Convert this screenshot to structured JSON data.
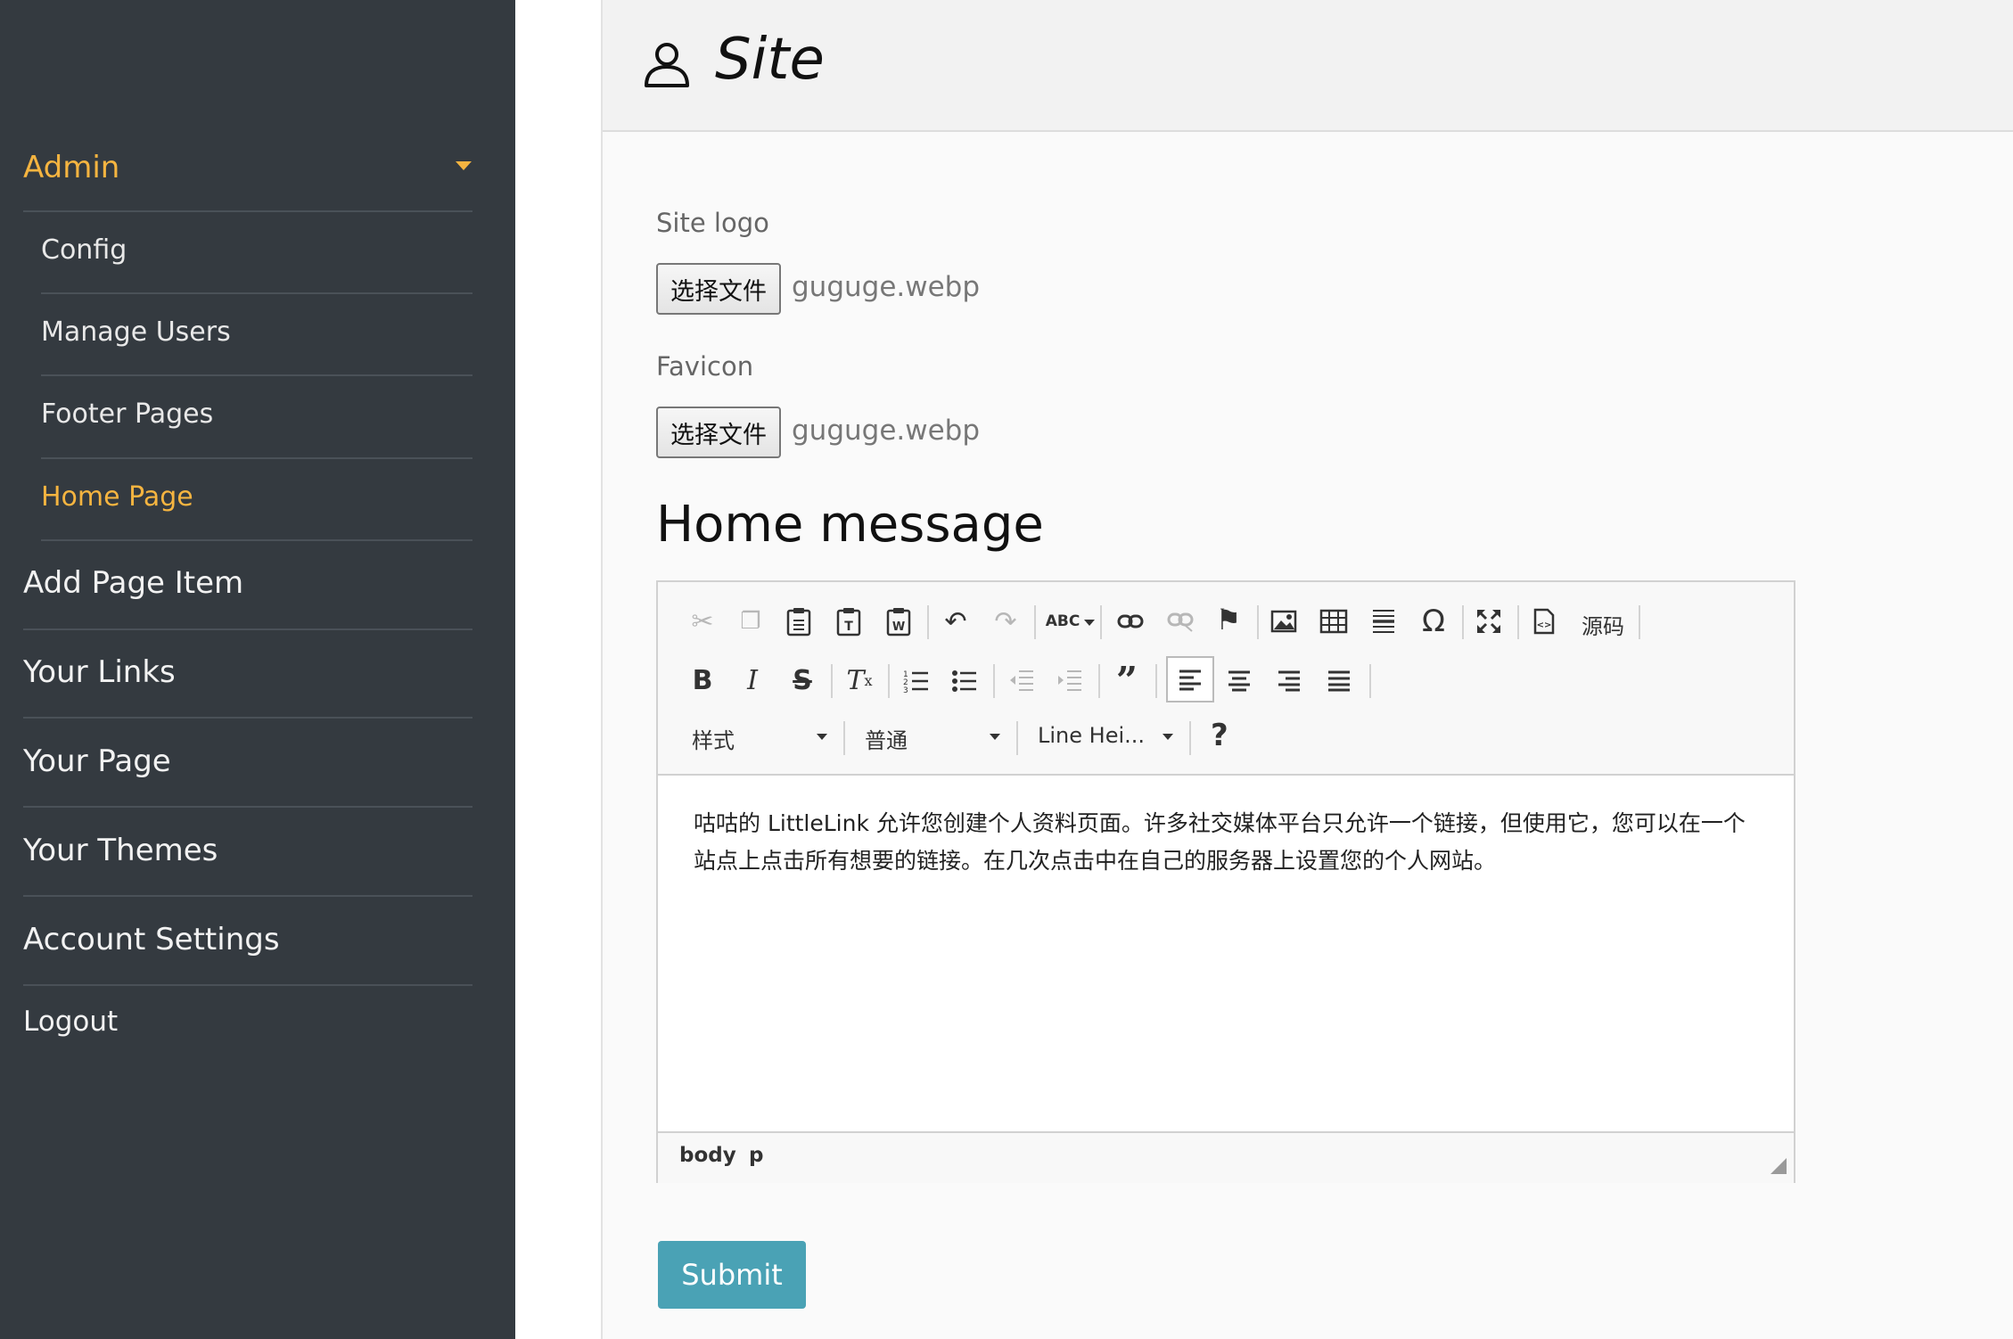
{
  "sidebar": {
    "admin_label": "Admin",
    "sub_items": [
      "Config",
      "Manage Users",
      "Footer Pages",
      "Home Page"
    ],
    "main_items": [
      "Add Page Item",
      "Your Links",
      "Your Page",
      "Your Themes",
      "Account Settings",
      "Logout"
    ]
  },
  "header": {
    "title": "Site"
  },
  "form": {
    "site_logo_label": "Site logo",
    "favicon_label": "Favicon",
    "choose_file_label": "选择文件",
    "site_logo_file": "guguge.webp",
    "favicon_file": "guguge.webp",
    "home_message_title": "Home message",
    "submit_label": "Submit"
  },
  "editor": {
    "source_label": "源码",
    "style_combo": "样式",
    "format_combo": "普通",
    "font_combo": "Line Hei...",
    "help_label": "?",
    "content": "咕咕的 LittleLink 允许您创建个人资料页面。许多社交媒体平台只允许一个链接，但使用它，您可以在一个站点上点击所有想要的链接。在几次点击中在自己的服务器上设置您的个人网站。",
    "path_body": "body",
    "path_p": "p"
  },
  "icons": {
    "cut": "✂",
    "copy": "⎘",
    "paste": "📋",
    "undo": "↶",
    "redo": "↷",
    "spellcheck": "ABC",
    "link": "⛓",
    "flag": "⚑",
    "table": "▦",
    "special_char": "Ω",
    "maximize": "⛶"
  }
}
